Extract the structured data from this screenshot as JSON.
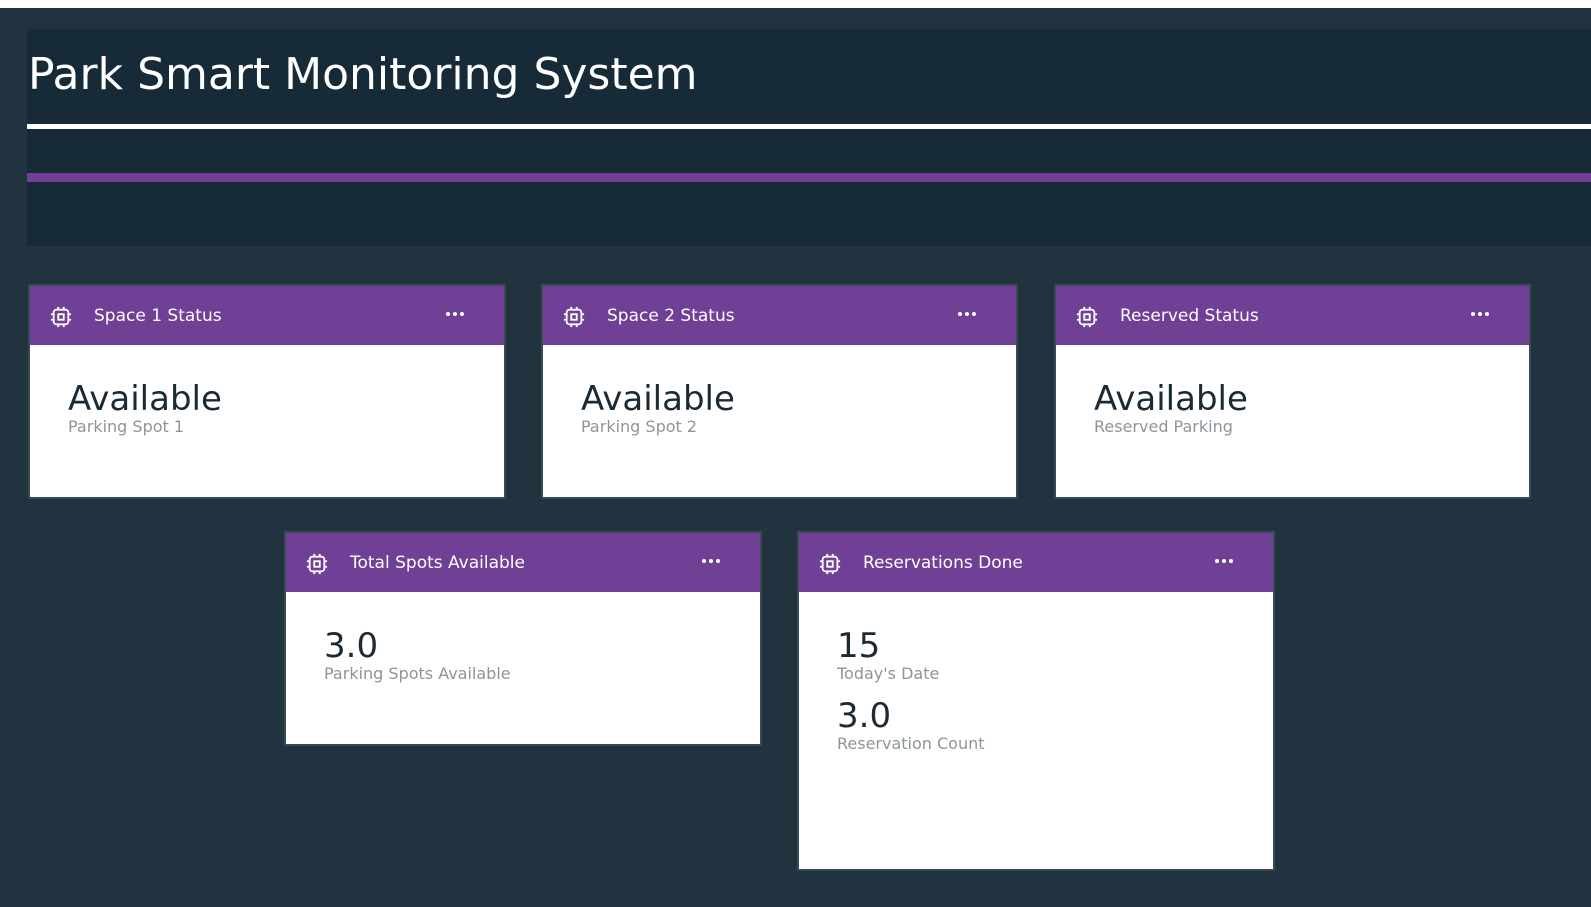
{
  "app": {
    "title": "Park Smart Monitoring System"
  },
  "colors": {
    "page_background": "#21333f",
    "header_background": "#172a38",
    "card_header": "#6f4096",
    "accent_rule": "#6f3f98",
    "value_text": "#1b2a33",
    "label_text": "#8c959b"
  },
  "cards": [
    {
      "title": "Space 1 Status",
      "icon": "chip-icon",
      "menu_icon": "more-options-icon",
      "metrics": [
        {
          "value": "Available",
          "label": "Parking Spot 1"
        }
      ]
    },
    {
      "title": "Space 2 Status",
      "icon": "chip-icon",
      "menu_icon": "more-options-icon",
      "metrics": [
        {
          "value": "Available",
          "label": "Parking Spot 2"
        }
      ]
    },
    {
      "title": "Reserved Status",
      "icon": "chip-icon",
      "menu_icon": "more-options-icon",
      "metrics": [
        {
          "value": "Available",
          "label": "Reserved Parking"
        }
      ]
    },
    {
      "title": "Total Spots Available",
      "icon": "chip-icon",
      "menu_icon": "more-options-icon",
      "metrics": [
        {
          "value": "3.0",
          "label": "Parking Spots Available"
        }
      ]
    },
    {
      "title": "Reservations Done",
      "icon": "chip-icon",
      "menu_icon": "more-options-icon",
      "metrics": [
        {
          "value": "15",
          "label": "Today's Date"
        },
        {
          "value": "3.0",
          "label": "Reservation Count"
        }
      ]
    }
  ]
}
